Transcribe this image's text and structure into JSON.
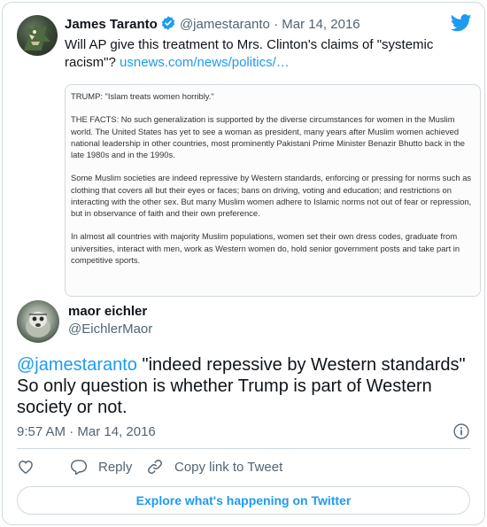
{
  "quoted_tweet": {
    "author_name": "James Taranto",
    "handle": "@jamestaranto",
    "separator": "·",
    "date": "Mar 14, 2016",
    "text": "Will AP give this treatment to Mrs. Clinton's claims of \"systemic racism\"?",
    "link_text": "usnews.com/news/politics/…",
    "verified": true,
    "logo_icon": "twitter-bird-icon",
    "article": {
      "paragraphs": [
        "TRUMP: \"Islam treats women horribly.\"",
        "THE FACTS: No such generalization is supported by the diverse circumstances for women in the Muslim world. The United States has yet to see a woman as president, many years after Muslim women achieved national leadership in other countries, most prominently Pakistani Prime Minister Benazir Bhutto back in the late 1980s and in the 1990s.",
        "Some Muslim societies are indeed repressive by Western standards, enforcing or pressing for norms such as clothing that covers all but their eyes or faces; bans on driving, voting and education; and restrictions on interacting with the other sex. But many Muslim women adhere to Islamic norms not out of fear or repression, but in observance of faith and their own preference.",
        "In almost all countries with majority Muslim populations, women set their own dress codes, graduate from universities, interact with men, work as Western women do, hold senior government posts and take part in competitive sports."
      ]
    }
  },
  "tweet": {
    "author_name": "maor eichler",
    "handle": "@EichlerMaor",
    "mention": "@jamestaranto",
    "text": " \"indeed repessive by Western standards\" So only question is whether Trump is part of Western society or not.",
    "time": "9:57 AM",
    "separator": "·",
    "date": "Mar 14, 2016"
  },
  "actions": {
    "like_icon": "heart-icon",
    "reply_label": "Reply",
    "copy_label": "Copy link to Tweet"
  },
  "explore_label": "Explore what's happening on Twitter",
  "colors": {
    "accent": "#1d9bf0",
    "text": "#0f1419",
    "secondary": "#536471",
    "border": "#cfd9de"
  }
}
